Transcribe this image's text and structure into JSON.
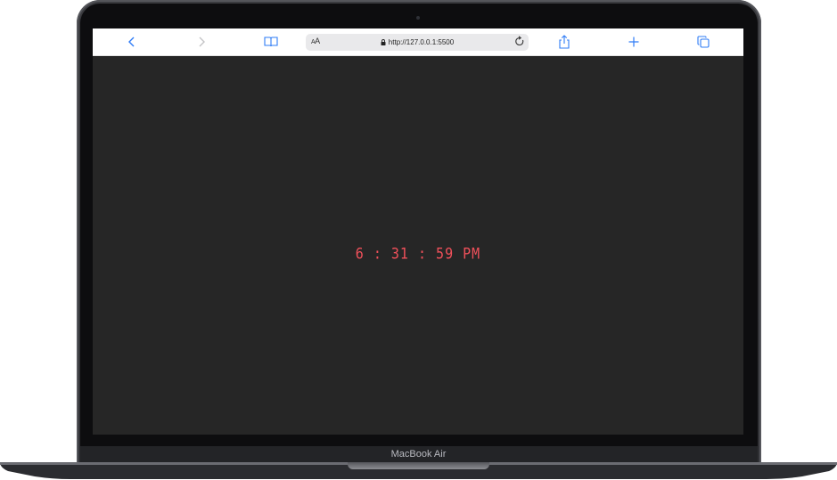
{
  "device": {
    "model_label": "MacBook Air"
  },
  "browser": {
    "text_size_button": "AA",
    "url": "http://127.0.0.1:5500",
    "icons": {
      "back": "chevron-left-icon",
      "forward": "chevron-right-icon",
      "bookmarks": "book-icon",
      "lock": "lock-icon",
      "reload": "reload-icon",
      "share": "share-icon",
      "new_tab": "plus-icon",
      "tabs": "tabs-icon"
    },
    "accent_color": "#2f7cf6"
  },
  "page": {
    "background_color": "#262626",
    "clock": {
      "time": "6 : 31 : 59 PM",
      "color": "#f0505a"
    }
  }
}
